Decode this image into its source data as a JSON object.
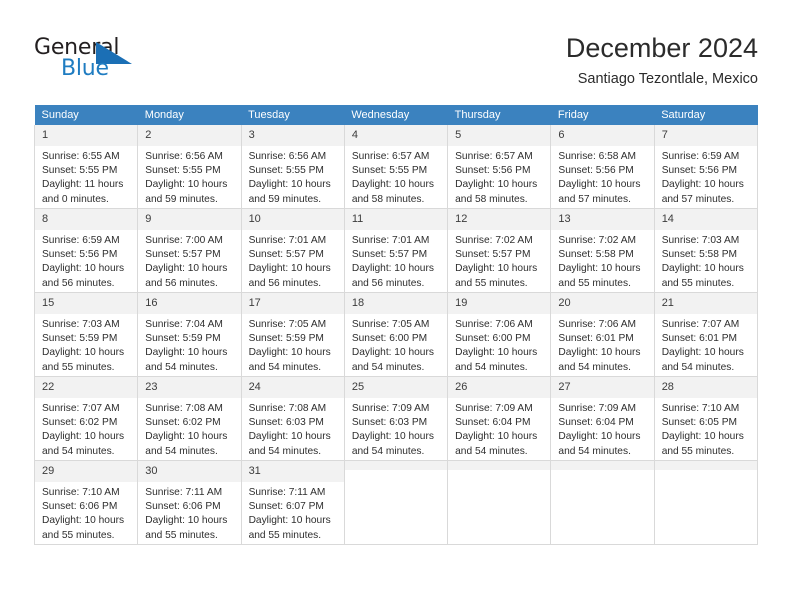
{
  "brand": {
    "name_part1": "General",
    "name_part2": "Blue",
    "accent_color": "#1b6fb5"
  },
  "header": {
    "title": "December 2024",
    "subtitle": "Santiago Tezontlale, Mexico"
  },
  "calendar": {
    "header_bg": "#3b82bf",
    "daynum_bg": "#f2f2f2",
    "weekday_headers": [
      "Sunday",
      "Monday",
      "Tuesday",
      "Wednesday",
      "Thursday",
      "Friday",
      "Saturday"
    ],
    "weeks": [
      [
        {
          "day": "1",
          "sunrise": "Sunrise: 6:55 AM",
          "sunset": "Sunset: 5:55 PM",
          "daylight_line1": "Daylight: 11 hours",
          "daylight_line2": "and 0 minutes."
        },
        {
          "day": "2",
          "sunrise": "Sunrise: 6:56 AM",
          "sunset": "Sunset: 5:55 PM",
          "daylight_line1": "Daylight: 10 hours",
          "daylight_line2": "and 59 minutes."
        },
        {
          "day": "3",
          "sunrise": "Sunrise: 6:56 AM",
          "sunset": "Sunset: 5:55 PM",
          "daylight_line1": "Daylight: 10 hours",
          "daylight_line2": "and 59 minutes."
        },
        {
          "day": "4",
          "sunrise": "Sunrise: 6:57 AM",
          "sunset": "Sunset: 5:55 PM",
          "daylight_line1": "Daylight: 10 hours",
          "daylight_line2": "and 58 minutes."
        },
        {
          "day": "5",
          "sunrise": "Sunrise: 6:57 AM",
          "sunset": "Sunset: 5:56 PM",
          "daylight_line1": "Daylight: 10 hours",
          "daylight_line2": "and 58 minutes."
        },
        {
          "day": "6",
          "sunrise": "Sunrise: 6:58 AM",
          "sunset": "Sunset: 5:56 PM",
          "daylight_line1": "Daylight: 10 hours",
          "daylight_line2": "and 57 minutes."
        },
        {
          "day": "7",
          "sunrise": "Sunrise: 6:59 AM",
          "sunset": "Sunset: 5:56 PM",
          "daylight_line1": "Daylight: 10 hours",
          "daylight_line2": "and 57 minutes."
        }
      ],
      [
        {
          "day": "8",
          "sunrise": "Sunrise: 6:59 AM",
          "sunset": "Sunset: 5:56 PM",
          "daylight_line1": "Daylight: 10 hours",
          "daylight_line2": "and 56 minutes."
        },
        {
          "day": "9",
          "sunrise": "Sunrise: 7:00 AM",
          "sunset": "Sunset: 5:57 PM",
          "daylight_line1": "Daylight: 10 hours",
          "daylight_line2": "and 56 minutes."
        },
        {
          "day": "10",
          "sunrise": "Sunrise: 7:01 AM",
          "sunset": "Sunset: 5:57 PM",
          "daylight_line1": "Daylight: 10 hours",
          "daylight_line2": "and 56 minutes."
        },
        {
          "day": "11",
          "sunrise": "Sunrise: 7:01 AM",
          "sunset": "Sunset: 5:57 PM",
          "daylight_line1": "Daylight: 10 hours",
          "daylight_line2": "and 56 minutes."
        },
        {
          "day": "12",
          "sunrise": "Sunrise: 7:02 AM",
          "sunset": "Sunset: 5:57 PM",
          "daylight_line1": "Daylight: 10 hours",
          "daylight_line2": "and 55 minutes."
        },
        {
          "day": "13",
          "sunrise": "Sunrise: 7:02 AM",
          "sunset": "Sunset: 5:58 PM",
          "daylight_line1": "Daylight: 10 hours",
          "daylight_line2": "and 55 minutes."
        },
        {
          "day": "14",
          "sunrise": "Sunrise: 7:03 AM",
          "sunset": "Sunset: 5:58 PM",
          "daylight_line1": "Daylight: 10 hours",
          "daylight_line2": "and 55 minutes."
        }
      ],
      [
        {
          "day": "15",
          "sunrise": "Sunrise: 7:03 AM",
          "sunset": "Sunset: 5:59 PM",
          "daylight_line1": "Daylight: 10 hours",
          "daylight_line2": "and 55 minutes."
        },
        {
          "day": "16",
          "sunrise": "Sunrise: 7:04 AM",
          "sunset": "Sunset: 5:59 PM",
          "daylight_line1": "Daylight: 10 hours",
          "daylight_line2": "and 54 minutes."
        },
        {
          "day": "17",
          "sunrise": "Sunrise: 7:05 AM",
          "sunset": "Sunset: 5:59 PM",
          "daylight_line1": "Daylight: 10 hours",
          "daylight_line2": "and 54 minutes."
        },
        {
          "day": "18",
          "sunrise": "Sunrise: 7:05 AM",
          "sunset": "Sunset: 6:00 PM",
          "daylight_line1": "Daylight: 10 hours",
          "daylight_line2": "and 54 minutes."
        },
        {
          "day": "19",
          "sunrise": "Sunrise: 7:06 AM",
          "sunset": "Sunset: 6:00 PM",
          "daylight_line1": "Daylight: 10 hours",
          "daylight_line2": "and 54 minutes."
        },
        {
          "day": "20",
          "sunrise": "Sunrise: 7:06 AM",
          "sunset": "Sunset: 6:01 PM",
          "daylight_line1": "Daylight: 10 hours",
          "daylight_line2": "and 54 minutes."
        },
        {
          "day": "21",
          "sunrise": "Sunrise: 7:07 AM",
          "sunset": "Sunset: 6:01 PM",
          "daylight_line1": "Daylight: 10 hours",
          "daylight_line2": "and 54 minutes."
        }
      ],
      [
        {
          "day": "22",
          "sunrise": "Sunrise: 7:07 AM",
          "sunset": "Sunset: 6:02 PM",
          "daylight_line1": "Daylight: 10 hours",
          "daylight_line2": "and 54 minutes."
        },
        {
          "day": "23",
          "sunrise": "Sunrise: 7:08 AM",
          "sunset": "Sunset: 6:02 PM",
          "daylight_line1": "Daylight: 10 hours",
          "daylight_line2": "and 54 minutes."
        },
        {
          "day": "24",
          "sunrise": "Sunrise: 7:08 AM",
          "sunset": "Sunset: 6:03 PM",
          "daylight_line1": "Daylight: 10 hours",
          "daylight_line2": "and 54 minutes."
        },
        {
          "day": "25",
          "sunrise": "Sunrise: 7:09 AM",
          "sunset": "Sunset: 6:03 PM",
          "daylight_line1": "Daylight: 10 hours",
          "daylight_line2": "and 54 minutes."
        },
        {
          "day": "26",
          "sunrise": "Sunrise: 7:09 AM",
          "sunset": "Sunset: 6:04 PM",
          "daylight_line1": "Daylight: 10 hours",
          "daylight_line2": "and 54 minutes."
        },
        {
          "day": "27",
          "sunrise": "Sunrise: 7:09 AM",
          "sunset": "Sunset: 6:04 PM",
          "daylight_line1": "Daylight: 10 hours",
          "daylight_line2": "and 54 minutes."
        },
        {
          "day": "28",
          "sunrise": "Sunrise: 7:10 AM",
          "sunset": "Sunset: 6:05 PM",
          "daylight_line1": "Daylight: 10 hours",
          "daylight_line2": "and 55 minutes."
        }
      ],
      [
        {
          "day": "29",
          "sunrise": "Sunrise: 7:10 AM",
          "sunset": "Sunset: 6:06 PM",
          "daylight_line1": "Daylight: 10 hours",
          "daylight_line2": "and 55 minutes."
        },
        {
          "day": "30",
          "sunrise": "Sunrise: 7:11 AM",
          "sunset": "Sunset: 6:06 PM",
          "daylight_line1": "Daylight: 10 hours",
          "daylight_line2": "and 55 minutes."
        },
        {
          "day": "31",
          "sunrise": "Sunrise: 7:11 AM",
          "sunset": "Sunset: 6:07 PM",
          "daylight_line1": "Daylight: 10 hours",
          "daylight_line2": "and 55 minutes."
        },
        {
          "day": "",
          "sunrise": "",
          "sunset": "",
          "daylight_line1": "",
          "daylight_line2": ""
        },
        {
          "day": "",
          "sunrise": "",
          "sunset": "",
          "daylight_line1": "",
          "daylight_line2": ""
        },
        {
          "day": "",
          "sunrise": "",
          "sunset": "",
          "daylight_line1": "",
          "daylight_line2": ""
        },
        {
          "day": "",
          "sunrise": "",
          "sunset": "",
          "daylight_line1": "",
          "daylight_line2": ""
        }
      ]
    ]
  }
}
